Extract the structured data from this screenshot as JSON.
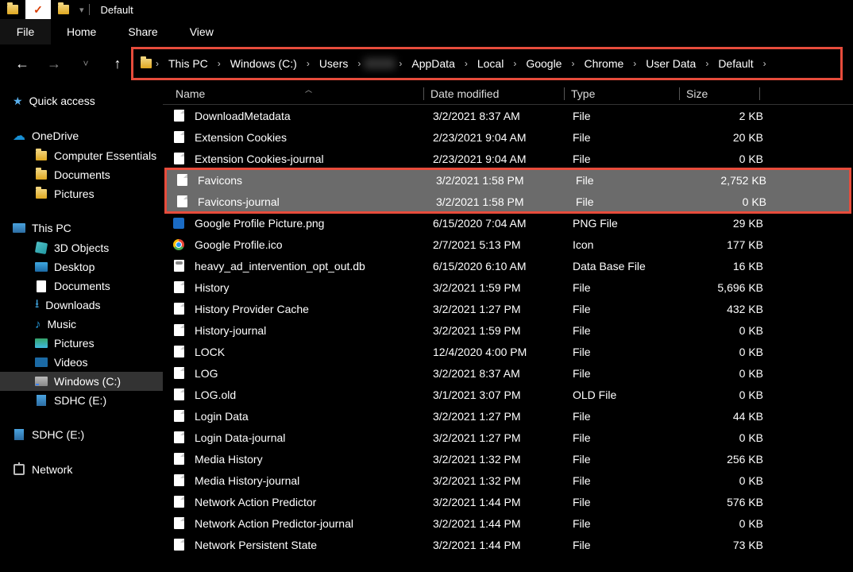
{
  "window": {
    "title": "Default"
  },
  "ribbon": {
    "file": "File",
    "tabs": [
      "Home",
      "Share",
      "View"
    ]
  },
  "breadcrumb": [
    "This PC",
    "Windows (C:)",
    "Users",
    "",
    "AppData",
    "Local",
    "Google",
    "Chrome",
    "User Data",
    "Default"
  ],
  "columns": {
    "name": "Name",
    "date": "Date modified",
    "type": "Type",
    "size": "Size"
  },
  "sidebar": {
    "quick_access": "Quick access",
    "onedrive": {
      "label": "OneDrive",
      "items": [
        "Computer Essentials",
        "Documents",
        "Pictures"
      ]
    },
    "this_pc": {
      "label": "This PC",
      "items": [
        "3D Objects",
        "Desktop",
        "Documents",
        "Downloads",
        "Music",
        "Pictures",
        "Videos",
        "Windows (C:)",
        "SDHC (E:)"
      ]
    },
    "sdhc": "SDHC (E:)",
    "network": "Network"
  },
  "files": [
    {
      "name": "DownloadMetadata",
      "date": "3/2/2021 8:37 AM",
      "type": "File",
      "size": "2 KB",
      "icon": "file"
    },
    {
      "name": "Extension Cookies",
      "date": "2/23/2021 9:04 AM",
      "type": "File",
      "size": "20 KB",
      "icon": "file"
    },
    {
      "name": "Extension Cookies-journal",
      "date": "2/23/2021 9:04 AM",
      "type": "File",
      "size": "0 KB",
      "icon": "file"
    },
    {
      "name": "Favicons",
      "date": "3/2/2021 1:58 PM",
      "type": "File",
      "size": "2,752 KB",
      "icon": "file",
      "selected": true
    },
    {
      "name": "Favicons-journal",
      "date": "3/2/2021 1:58 PM",
      "type": "File",
      "size": "0 KB",
      "icon": "file",
      "selected": true
    },
    {
      "name": "Google Profile Picture.png",
      "date": "6/15/2020 7:04 AM",
      "type": "PNG File",
      "size": "29 KB",
      "icon": "png"
    },
    {
      "name": "Google Profile.ico",
      "date": "2/7/2021 5:13 PM",
      "type": "Icon",
      "size": "177 KB",
      "icon": "chrome"
    },
    {
      "name": "heavy_ad_intervention_opt_out.db",
      "date": "6/15/2020 6:10 AM",
      "type": "Data Base File",
      "size": "16 KB",
      "icon": "db"
    },
    {
      "name": "History",
      "date": "3/2/2021 1:59 PM",
      "type": "File",
      "size": "5,696 KB",
      "icon": "file"
    },
    {
      "name": "History Provider Cache",
      "date": "3/2/2021 1:27 PM",
      "type": "File",
      "size": "432 KB",
      "icon": "file"
    },
    {
      "name": "History-journal",
      "date": "3/2/2021 1:59 PM",
      "type": "File",
      "size": "0 KB",
      "icon": "file"
    },
    {
      "name": "LOCK",
      "date": "12/4/2020 4:00 PM",
      "type": "File",
      "size": "0 KB",
      "icon": "file"
    },
    {
      "name": "LOG",
      "date": "3/2/2021 8:37 AM",
      "type": "File",
      "size": "0 KB",
      "icon": "file"
    },
    {
      "name": "LOG.old",
      "date": "3/1/2021 3:07 PM",
      "type": "OLD File",
      "size": "0 KB",
      "icon": "file"
    },
    {
      "name": "Login Data",
      "date": "3/2/2021 1:27 PM",
      "type": "File",
      "size": "44 KB",
      "icon": "file"
    },
    {
      "name": "Login Data-journal",
      "date": "3/2/2021 1:27 PM",
      "type": "File",
      "size": "0 KB",
      "icon": "file"
    },
    {
      "name": "Media History",
      "date": "3/2/2021 1:32 PM",
      "type": "File",
      "size": "256 KB",
      "icon": "file"
    },
    {
      "name": "Media History-journal",
      "date": "3/2/2021 1:32 PM",
      "type": "File",
      "size": "0 KB",
      "icon": "file"
    },
    {
      "name": "Network Action Predictor",
      "date": "3/2/2021 1:44 PM",
      "type": "File",
      "size": "576 KB",
      "icon": "file"
    },
    {
      "name": "Network Action Predictor-journal",
      "date": "3/2/2021 1:44 PM",
      "type": "File",
      "size": "0 KB",
      "icon": "file"
    },
    {
      "name": "Network Persistent State",
      "date": "3/2/2021 1:44 PM",
      "type": "File",
      "size": "73 KB",
      "icon": "file"
    }
  ]
}
